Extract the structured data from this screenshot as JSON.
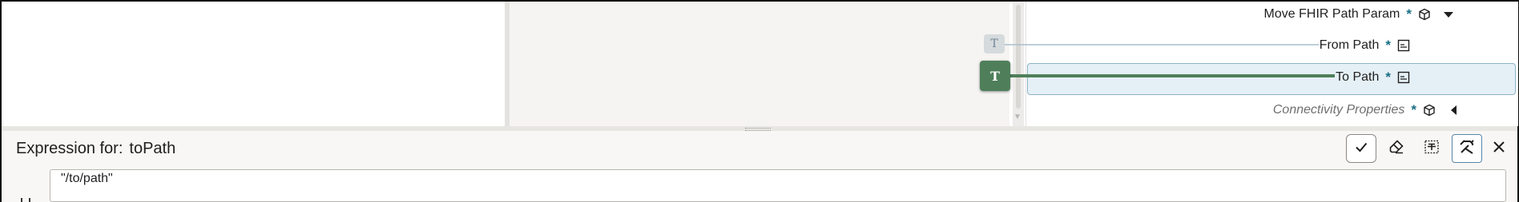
{
  "mapper": {
    "target_rows": [
      {
        "label": "Move FHIR Path Param",
        "required": "*",
        "icon": "object-cube-icon",
        "toggle": "caret-down-icon",
        "style": "normal"
      },
      {
        "label": "From Path",
        "required": "*",
        "icon": "string-field-icon",
        "style": "normal"
      },
      {
        "label": "To Path",
        "required": "*",
        "icon": "string-field-icon",
        "style": "selected"
      },
      {
        "label": "Connectivity Properties",
        "required": "*",
        "icon": "object-cube-icon",
        "toggle": "caret-left-icon",
        "style": "italic"
      }
    ],
    "nodes": {
      "from_path_node": "T",
      "to_path_node": "T"
    },
    "colors": {
      "required_marker": "#1b6f86",
      "active_link": "#4f7f5a",
      "inactive_link": "#a9bfcc",
      "selected_row_bg": "#e5f0f6"
    }
  },
  "expression": {
    "label": "Expression for:",
    "target": "toPath",
    "value": "\"/to/path\""
  },
  "toolbar": {
    "buttons": [
      "check-icon",
      "eraser-icon",
      "text-format-icon",
      "tools-icon",
      "close-icon"
    ]
  }
}
